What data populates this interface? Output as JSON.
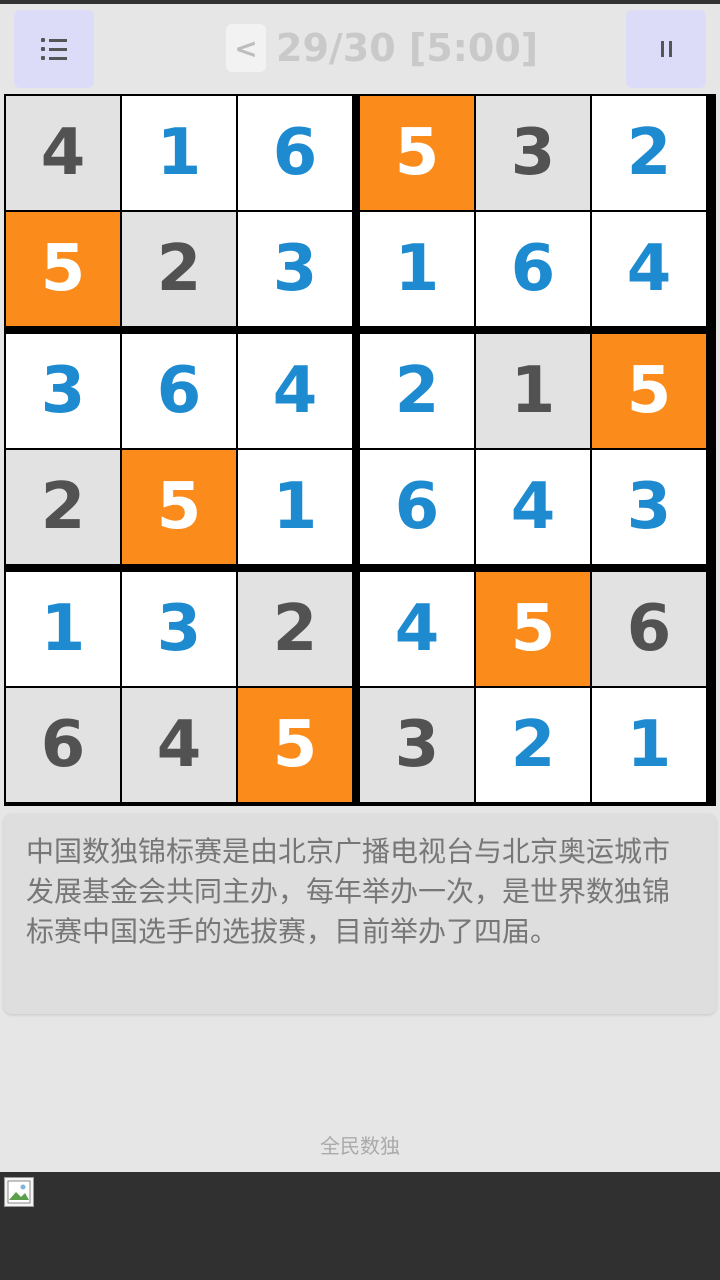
{
  "header": {
    "menu_icon": "list-menu-icon",
    "prev_label": "<",
    "status": "29/30 [5:00]",
    "pause_icon": "pause-icon"
  },
  "board": {
    "size": 6,
    "box_rows": 2,
    "box_cols": 3,
    "colors": {
      "given": "#e2e2e2",
      "entered": "#ffffff",
      "highlight": "#fb8c1c",
      "given_text": "#525252",
      "entered_text": "#1e8bd1"
    },
    "cells": [
      [
        {
          "v": "4",
          "t": "given"
        },
        {
          "v": "1",
          "t": "entered"
        },
        {
          "v": "6",
          "t": "entered"
        },
        {
          "v": "5",
          "t": "highlight"
        },
        {
          "v": "3",
          "t": "given"
        },
        {
          "v": "2",
          "t": "entered"
        }
      ],
      [
        {
          "v": "5",
          "t": "highlight"
        },
        {
          "v": "2",
          "t": "given"
        },
        {
          "v": "3",
          "t": "entered"
        },
        {
          "v": "1",
          "t": "entered"
        },
        {
          "v": "6",
          "t": "entered"
        },
        {
          "v": "4",
          "t": "entered"
        }
      ],
      [
        {
          "v": "3",
          "t": "entered"
        },
        {
          "v": "6",
          "t": "entered"
        },
        {
          "v": "4",
          "t": "entered"
        },
        {
          "v": "2",
          "t": "entered"
        },
        {
          "v": "1",
          "t": "given"
        },
        {
          "v": "5",
          "t": "highlight"
        }
      ],
      [
        {
          "v": "2",
          "t": "given"
        },
        {
          "v": "5",
          "t": "highlight"
        },
        {
          "v": "1",
          "t": "entered"
        },
        {
          "v": "6",
          "t": "entered"
        },
        {
          "v": "4",
          "t": "entered"
        },
        {
          "v": "3",
          "t": "entered"
        }
      ],
      [
        {
          "v": "1",
          "t": "entered"
        },
        {
          "v": "3",
          "t": "entered"
        },
        {
          "v": "2",
          "t": "given"
        },
        {
          "v": "4",
          "t": "entered"
        },
        {
          "v": "5",
          "t": "highlight"
        },
        {
          "v": "6",
          "t": "given"
        }
      ],
      [
        {
          "v": "6",
          "t": "given"
        },
        {
          "v": "4",
          "t": "given"
        },
        {
          "v": "5",
          "t": "highlight"
        },
        {
          "v": "3",
          "t": "given"
        },
        {
          "v": "2",
          "t": "entered"
        },
        {
          "v": "1",
          "t": "entered"
        }
      ]
    ]
  },
  "info": {
    "text": "中国数独锦标赛是由北京广播电视台与北京奥运城市发展基金会共同主办，每年举办一次，是世界数独锦标赛中国选手的选拔赛，目前举办了四届。"
  },
  "footer": {
    "text": "全民数独"
  },
  "ad": {
    "icon": "broken-image-icon"
  }
}
